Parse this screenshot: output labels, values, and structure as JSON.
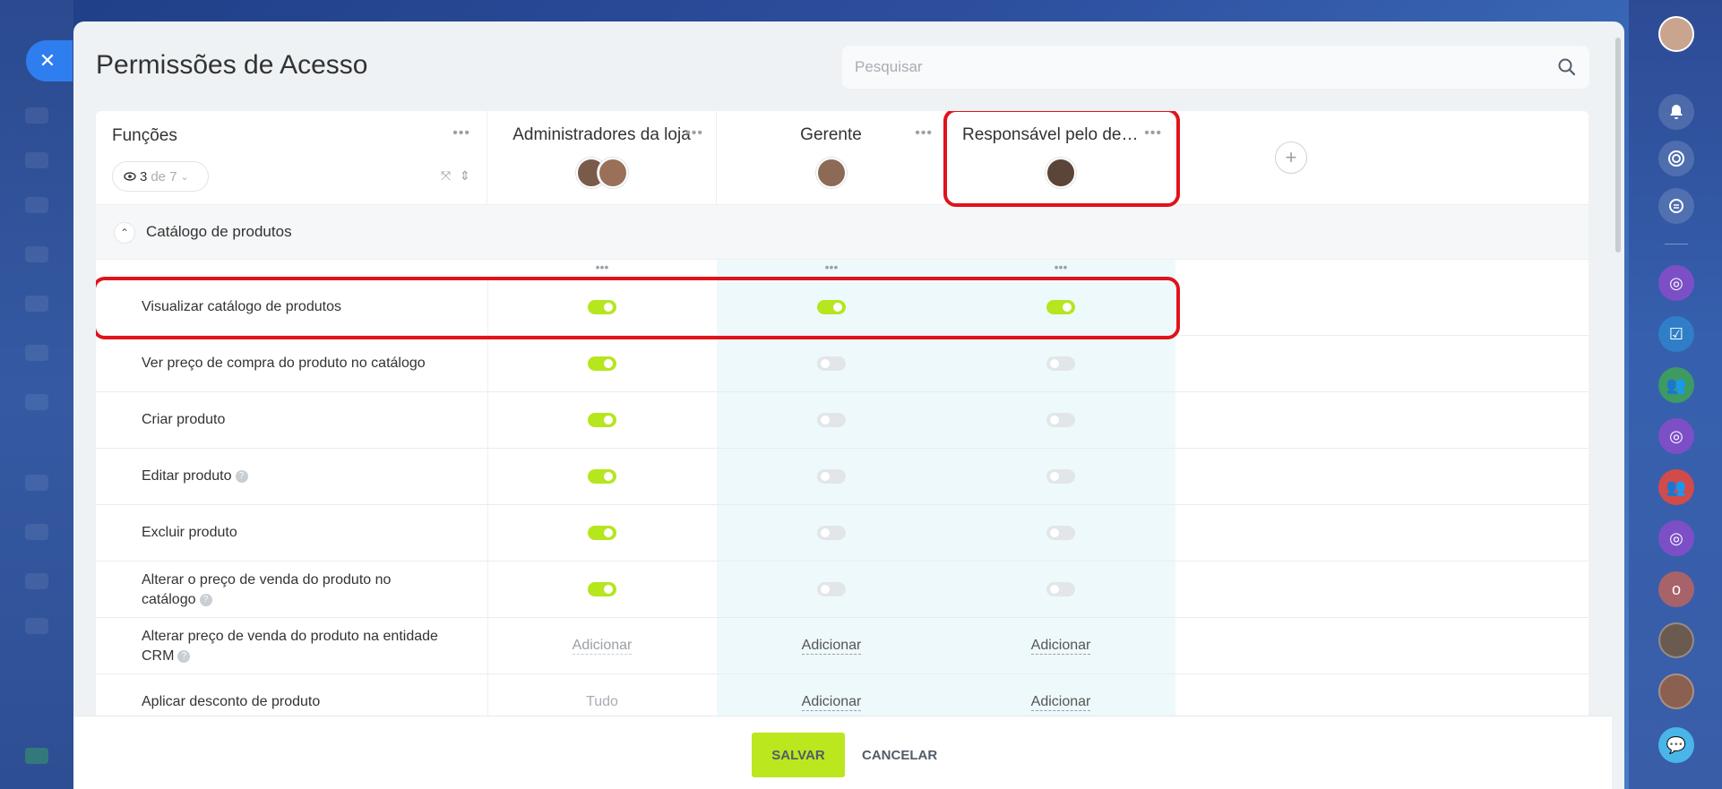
{
  "page": {
    "title": "Permissões de Acesso"
  },
  "search": {
    "placeholder": "Pesquisar"
  },
  "functions_header": {
    "title": "Funções",
    "visible_count": "3",
    "of_label": "de 7"
  },
  "roles": [
    {
      "name": "Administradores da loja",
      "avatars": 2
    },
    {
      "name": "Gerente",
      "avatars": 1
    },
    {
      "name": "Responsável pelo dep...",
      "avatars": 1
    }
  ],
  "section": {
    "label": "Catálogo de produtos"
  },
  "rows": [
    {
      "label": "Visualizar catálogo de produtos",
      "help": false,
      "values": [
        "on",
        "on",
        "on"
      ]
    },
    {
      "label": "Ver preço de compra do produto no catálogo",
      "help": false,
      "values": [
        "on",
        "off",
        "off"
      ]
    },
    {
      "label": "Criar produto",
      "help": false,
      "values": [
        "on",
        "off",
        "off"
      ]
    },
    {
      "label": "Editar produto",
      "help": true,
      "values": [
        "on",
        "off",
        "off"
      ]
    },
    {
      "label": "Excluir produto",
      "help": false,
      "values": [
        "on",
        "off",
        "off"
      ]
    },
    {
      "label": "Alterar o preço de venda do produto no catálogo",
      "help": true,
      "values": [
        "on",
        "off",
        "off"
      ]
    },
    {
      "label": "Alterar preço de venda do produto na entidade CRM",
      "help": true,
      "values": [
        "Adicionar",
        "Adicionar",
        "Adicionar"
      ]
    },
    {
      "label": "Aplicar desconto de produto",
      "help": false,
      "values": [
        "Tudo",
        "Adicionar",
        "Adicionar"
      ]
    }
  ],
  "footer": {
    "save_label": "SALVAR",
    "cancel_label": "CANCELAR"
  },
  "colors": {
    "accent": "#bbe71f",
    "toggle_on": "#b5e61e",
    "highlight": "#e0131b",
    "close_button": "#2f7ef0"
  }
}
